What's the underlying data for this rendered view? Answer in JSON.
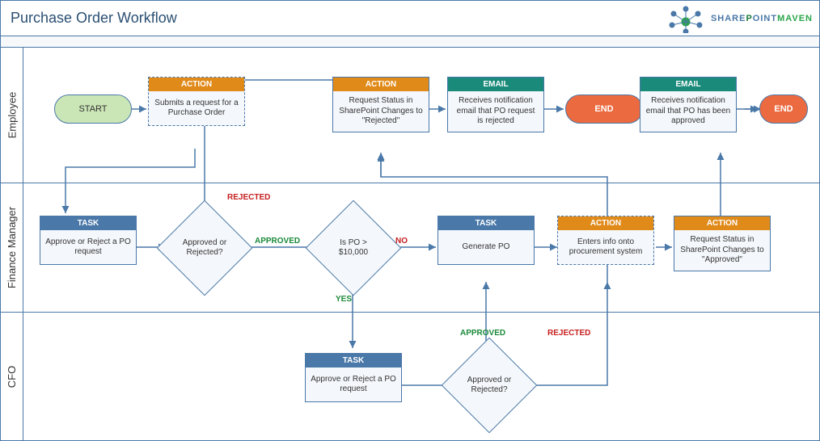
{
  "header": {
    "title": "Purchase Order Workflow",
    "logo": {
      "share": "SHARE",
      "p": "P",
      "oint": "OINT",
      "maven": "MAVEN"
    }
  },
  "lanes": {
    "employee": "Employee",
    "finance": "Finance Manager",
    "cfo": "CFO"
  },
  "labels": {
    "start": "START",
    "end": "END",
    "task": "TASK",
    "action": "ACTION",
    "email": "EMAIL",
    "approved": "APPROVED",
    "rejected": "REJECTED",
    "yes": "YES",
    "no": "NO"
  },
  "nodes": {
    "emp_submit": "Submits a request for a Purchase Order",
    "emp_reject_status": "Request Status in SharePoint Changes to \"Rejected\"",
    "emp_reject_email": "Receives notification email that PO request is rejected",
    "emp_approve_email": "Receives notification email that PO has been approved",
    "fin_task_approve": "Approve or Reject a PO request",
    "fin_decision": "Approved or Rejected?",
    "fin_threshold": "Is PO > $10,000",
    "fin_task_genpo": "Generate PO",
    "fin_action_enter": "Enters info onto procurement system",
    "fin_action_approved": "Request Status in SharePoint Changes to \"Approved\"",
    "cfo_task_approve": "Approve or Reject a PO request",
    "cfo_decision": "Approved or Rejected?"
  }
}
